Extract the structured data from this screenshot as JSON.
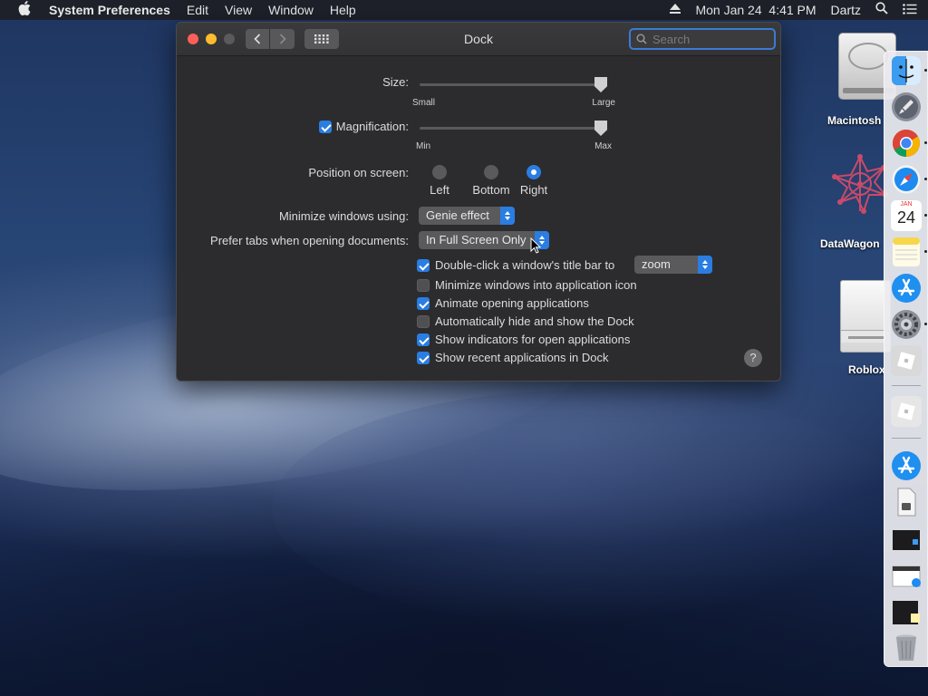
{
  "menubar": {
    "apple_icon": "apple-icon",
    "app_name": "System Preferences",
    "items": [
      "Edit",
      "View",
      "Window",
      "Help"
    ],
    "datetime": "Mon Jan 24  4:41 PM",
    "user": "Dartz"
  },
  "window": {
    "title": "Dock",
    "search_placeholder": "Search"
  },
  "size": {
    "label": "Size:",
    "min_label": "Small",
    "max_label": "Large",
    "value_fraction": 1.0
  },
  "magnification": {
    "label": "Magnification:",
    "checked": true,
    "min_label": "Min",
    "max_label": "Max",
    "value_fraction": 1.0
  },
  "position": {
    "label": "Position on screen:",
    "options": [
      "Left",
      "Bottom",
      "Right"
    ],
    "selected": "Right"
  },
  "minimize": {
    "label": "Minimize windows using:",
    "value": "Genie effect"
  },
  "prefer_tabs": {
    "label": "Prefer tabs when opening documents:",
    "value": "In Full Screen Only"
  },
  "double_click": {
    "label": "Double-click a window's title bar to",
    "checked": true,
    "value": "zoom"
  },
  "options": [
    {
      "label": "Minimize windows into application icon",
      "checked": false
    },
    {
      "label": "Animate opening applications",
      "checked": true
    },
    {
      "label": "Automatically hide and show the Dock",
      "checked": false
    },
    {
      "label": "Show indicators for open applications",
      "checked": true
    },
    {
      "label": "Show recent applications in Dock",
      "checked": true
    }
  ],
  "help_label": "?",
  "desktop_icons": [
    {
      "label": "Macintosh",
      "icon": "hard-drive-icon"
    },
    {
      "label": "DataWagon",
      "icon": "datawagon-icon"
    },
    {
      "label": "Roblox",
      "icon": "disk-image-icon"
    }
  ],
  "dock": {
    "calendar_month": "JAN",
    "calendar_day": "24",
    "items": [
      "finder-icon",
      "launchpad-icon",
      "chrome-icon",
      "safari-icon",
      "calendar-icon",
      "notes-icon",
      "app-store-icon",
      "system-preferences-icon",
      "roblox-icon",
      "roblox-studio-icon",
      "app-store-recent-icon",
      "document-icon",
      "window-thumbnail-icon",
      "safari-window-icon",
      "notes-window-icon",
      "trash-icon"
    ]
  }
}
